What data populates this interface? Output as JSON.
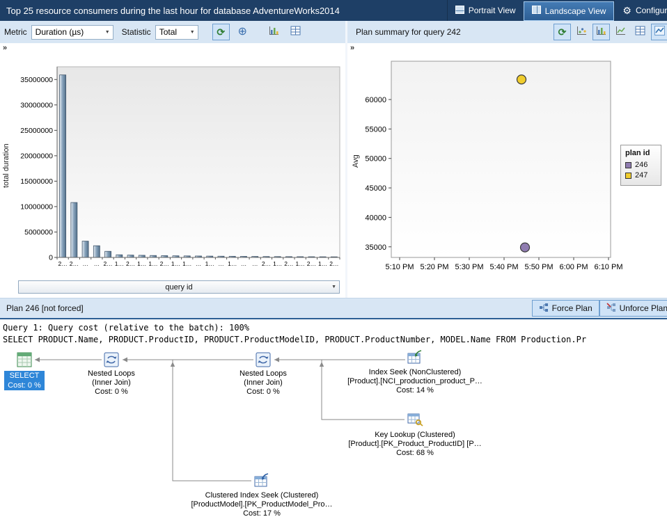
{
  "title_bar": {
    "title": "Top 25 resource consumers during the last hour for database AdventureWorks2014",
    "portrait_button": "Portrait View",
    "landscape_button": "Landscape View",
    "configure_button": "Configure"
  },
  "toolbar": {
    "metric_label": "Metric",
    "metric_value": "Duration (µs)",
    "statistic_label": "Statistic",
    "statistic_value": "Total",
    "plan_summary_title": "Plan summary for query 242"
  },
  "icons": {
    "collapse": "»",
    "dropdown": "▼",
    "refresh": "⟳",
    "crosshair": "⊕",
    "gear": "⚙"
  },
  "chart_data": [
    {
      "type": "bar",
      "title": "Top 25 resource consumers",
      "xlabel": "query id",
      "ylabel": "total duration",
      "ylim": [
        0,
        37500000
      ],
      "yticks": [
        0,
        5000000,
        10000000,
        15000000,
        20000000,
        25000000,
        30000000,
        35000000
      ],
      "grid": false,
      "categories": [
        "2…",
        "2…",
        "…",
        "…",
        "2…",
        "1…",
        "2…",
        "1…",
        "1…",
        "2…",
        "1…",
        "1…",
        "…",
        "1…",
        "…",
        "1…",
        "…",
        "…",
        "2…",
        "1…",
        "2…",
        "1…",
        "2…",
        "1…",
        "2…"
      ],
      "values": [
        35900000,
        10800000,
        3200000,
        2300000,
        1200000,
        520000,
        460000,
        420000,
        380000,
        350000,
        320000,
        300000,
        280000,
        260000,
        240000,
        225000,
        210000,
        195000,
        180000,
        170000,
        160000,
        150000,
        140000,
        130000,
        120000
      ]
    },
    {
      "type": "scatter",
      "title": "Plan summary for query 242",
      "xlabel": "",
      "ylabel": "Avg",
      "ylim": [
        33200,
        66500
      ],
      "yticks": [
        35000,
        40000,
        45000,
        50000,
        55000,
        60000
      ],
      "x_ticks": [
        "5:10 PM",
        "5:20 PM",
        "5:30 PM",
        "5:40 PM",
        "5:50 PM",
        "6:00 PM",
        "6:10 PM"
      ],
      "legend_title": "plan id",
      "legend_position": "right",
      "series": [
        {
          "name": "246",
          "color": "#8f7cb0",
          "points": [
            {
              "time": "5:46 PM",
              "minutes": 36,
              "value": 34900
            }
          ]
        },
        {
          "name": "247",
          "color": "#f0cd2e",
          "points": [
            {
              "time": "5:45 PM",
              "minutes": 35,
              "value": 63400
            }
          ]
        }
      ]
    }
  ],
  "plan": {
    "header": "Plan 246 [not forced]",
    "force_plan_button": "Force Plan",
    "unforce_plan_button": "Unforce Plan",
    "query_line1": "Query 1: Query cost (relative to the batch): 100%",
    "query_line2": "SELECT PRODUCT.Name, PRODUCT.ProductID, PRODUCT.ProductModelID, PRODUCT.ProductNumber, MODEL.Name FROM Production.Pr",
    "nodes": [
      {
        "name": "select",
        "lines": [
          "SELECT",
          "Cost: 0 %"
        ]
      },
      {
        "name": "nested-loops-1",
        "lines": [
          "Nested Loops",
          "(Inner Join)",
          "Cost: 0 %"
        ]
      },
      {
        "name": "nested-loops-2",
        "lines": [
          "Nested Loops",
          "(Inner Join)",
          "Cost: 0 %"
        ]
      },
      {
        "name": "index-seek",
        "lines": [
          "Index Seek (NonClustered)",
          "[Product].[NCI_production_product_P…",
          "Cost: 14 %"
        ]
      },
      {
        "name": "key-lookup",
        "lines": [
          "Key Lookup (Clustered)",
          "[Product].[PK_Product_ProductID] [P…",
          "Cost: 68 %"
        ]
      },
      {
        "name": "clustered-index-seek",
        "lines": [
          "Clustered Index Seek (Clustered)",
          "[ProductModel].[PK_ProductModel_Pro…",
          "Cost: 17 %"
        ]
      }
    ]
  }
}
